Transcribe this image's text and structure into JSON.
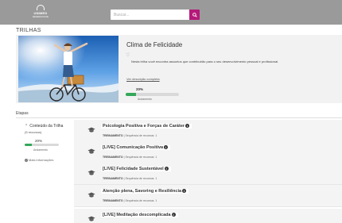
{
  "header": {
    "logo_text": "UNIMED",
    "logo_sub": "DESENVOLVE",
    "search_placeholder": "Buscar...",
    "search_icon": "search-icon",
    "search_button_color": "#b5197a"
  },
  "page": {
    "section_title": "TRILHAS"
  },
  "trail": {
    "title": "Clima de Felicidade",
    "favorite_icon": "heart-icon",
    "description": "Nesta trilha você encontra assuntos que contribuirão para o seu desenvolvimento pessoal e profissional.",
    "link": "Ver descrição completa",
    "progress": {
      "percent_label": "20%",
      "fraction": 0.2,
      "status": "Andamento"
    }
  },
  "steps": {
    "label": "Etapas",
    "sidebar": {
      "title": "Conteúdo da Trilha",
      "count": "(5 recursos)",
      "percent_label": "20%",
      "fraction": 0.2,
      "status": "Andamento",
      "more_info": "Mais informações"
    },
    "items": [
      {
        "title": "Psicologia Positiva e Forças de Caráter",
        "type": "TREINAMENTO",
        "meta": "Sequência de recursos: 1"
      },
      {
        "title": "[LIVE] Comunicação Positiva",
        "type": "TREINAMENTO",
        "meta": "Sequência de recursos: 1"
      },
      {
        "title": "[LIVE] Felicidade Sustentável",
        "type": "TREINAMENTO",
        "meta": "Sequência de recursos: 1"
      },
      {
        "title": "Atenção plena, Savoring e Resiliência",
        "type": "TREINAMENTO",
        "meta": "Sequência de recursos: 1"
      },
      {
        "title": "[LIVE] Meditação descomplicada",
        "type": "TREINAMENTO",
        "meta": "Sequência de recursos: 1"
      }
    ]
  },
  "colors": {
    "progress_fill": "#33a85a",
    "accent": "#b5197a",
    "topbar": "#9a9a9a"
  }
}
